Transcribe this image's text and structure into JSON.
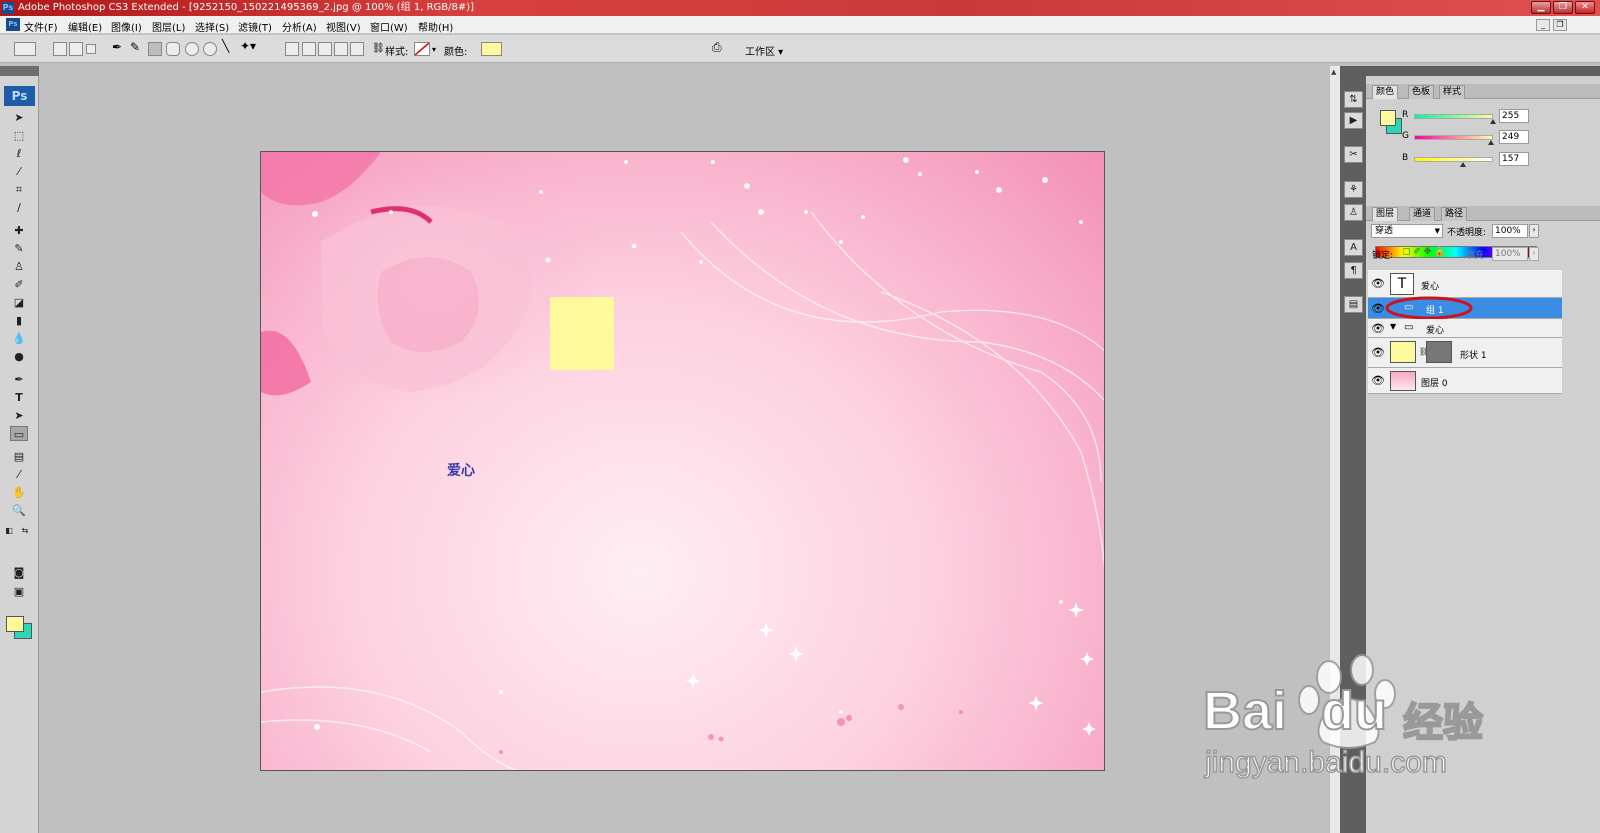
{
  "window": {
    "title": "Adobe Photoshop CS3 Extended - [9252150_150221495369_2.jpg @ 100% (组 1, RGB/8#)]",
    "app_icon": "Ps",
    "min": "▁",
    "max": "❐",
    "close": "✕"
  },
  "menu": {
    "items": [
      "文件(F)",
      "编辑(E)",
      "图像(I)",
      "图层(L)",
      "选择(S)",
      "滤镜(T)",
      "分析(A)",
      "视图(V)",
      "窗口(W)",
      "帮助(H)"
    ],
    "doc_min": "_",
    "doc_restore": "❐"
  },
  "options": {
    "style_label": "样式:",
    "color_label": "颜色:",
    "color_value": "#fff99d",
    "workspace_label": "工作区 ▾"
  },
  "toolbox": {
    "logo": "Ps",
    "foreground": "#fff99d",
    "background": "#29d7b9"
  },
  "canvas": {
    "text_layer": "爱心",
    "shape_color": "#fff99d"
  },
  "color_panel": {
    "tabs": [
      "颜色",
      "色板",
      "样式"
    ],
    "fg": "#fff99d",
    "bg": "#29d7b9",
    "sliders": [
      {
        "label": "R",
        "value": "255",
        "level": 1.0
      },
      {
        "label": "G",
        "value": "249",
        "level": 0.976
      },
      {
        "label": "B",
        "value": "157",
        "level": 0.616
      }
    ]
  },
  "layers_panel": {
    "tabs": [
      "图层",
      "通道",
      "路径"
    ],
    "blend_mode": "穿透",
    "opacity_label": "不透明度:",
    "opacity_value": "100%",
    "lock_label": "锁定:",
    "fill_label": "填充:",
    "fill_value": "100%",
    "layers": [
      {
        "name": "爱心",
        "kind": "text",
        "thumb": "T"
      },
      {
        "name": "组 1",
        "kind": "group",
        "selected": true
      },
      {
        "name": "爱心",
        "kind": "group"
      },
      {
        "name": "形状 1",
        "kind": "shape"
      },
      {
        "name": "图层 0",
        "kind": "image"
      }
    ]
  },
  "watermark": {
    "brand_left": "Bai",
    "brand_right": "du",
    "product": "经验",
    "url": "jingyan.baidu.com"
  }
}
